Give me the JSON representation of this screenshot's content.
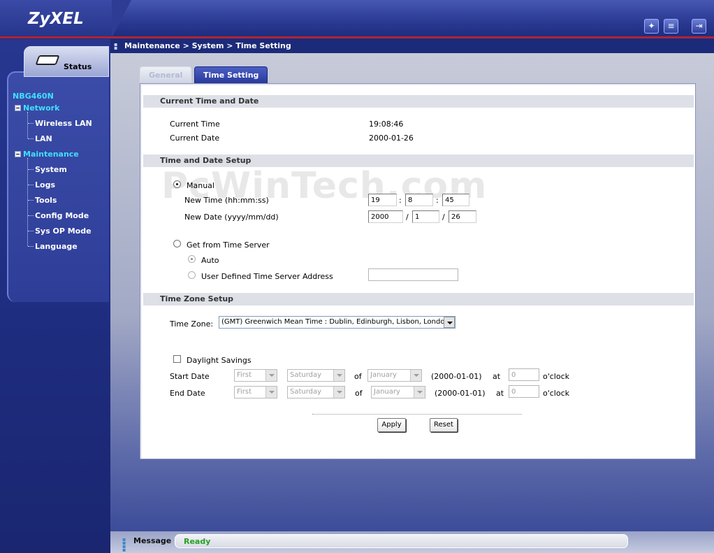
{
  "header": {
    "brand": "ZyXEL",
    "icons": [
      "wizard-icon",
      "notes-icon",
      "logout-icon"
    ]
  },
  "nav": {
    "status_label": "Status",
    "model": "NBG460N",
    "categories": [
      {
        "label": "Network",
        "items": [
          "Wireless LAN",
          "LAN"
        ]
      },
      {
        "label": "Maintenance",
        "items": [
          "System",
          "Logs",
          "Tools",
          "Config Mode",
          "Sys OP Mode",
          "Language"
        ]
      }
    ]
  },
  "breadcrumb": "Maintenance > System > Time Setting",
  "tabs": [
    {
      "label": "General",
      "active": false
    },
    {
      "label": "Time Setting",
      "active": true
    }
  ],
  "watermark": "PcWinTech.com",
  "current": {
    "section": "Current Time and Date",
    "time_label": "Current Time",
    "time_value": "19:08:46",
    "date_label": "Current Date",
    "date_value": "2000-01-26"
  },
  "setup": {
    "section": "Time and Date Setup",
    "manual_label": "Manual",
    "manual_selected": true,
    "new_time_label": "New Time (hh:mm:ss)",
    "hour": "19",
    "minute": "8",
    "second": "45",
    "time_sep": ":",
    "new_date_label": "New Date (yyyy/mm/dd)",
    "year": "2000",
    "month": "1",
    "day": "26",
    "date_sep": "/",
    "server_label": "Get from Time Server",
    "auto_label": "Auto",
    "user_defined_label": "User Defined Time Server Address",
    "server_address": ""
  },
  "timezone": {
    "section": "Time Zone Setup",
    "label": "Time Zone:",
    "value": "(GMT) Greenwich Mean Time : Dublin, Edinburgh, Lisbon, London",
    "daylight_label": "Daylight Savings",
    "daylight_checked": false,
    "start_label": "Start Date",
    "end_label": "End Date",
    "start": {
      "week": "First",
      "day": "Saturday",
      "of": "of",
      "month": "January",
      "date": "(2000-01-01)",
      "at": "at",
      "hour": "0",
      "oclock": "o'clock"
    },
    "end": {
      "week": "First",
      "day": "Saturday",
      "of": "of",
      "month": "January",
      "date": "(2000-01-01)",
      "at": "at",
      "hour": "0",
      "oclock": "o'clock"
    }
  },
  "buttons": {
    "apply": "Apply",
    "reset": "Reset"
  },
  "footer": {
    "label": "Message",
    "status": "Ready",
    "status_color": "#27a023"
  }
}
